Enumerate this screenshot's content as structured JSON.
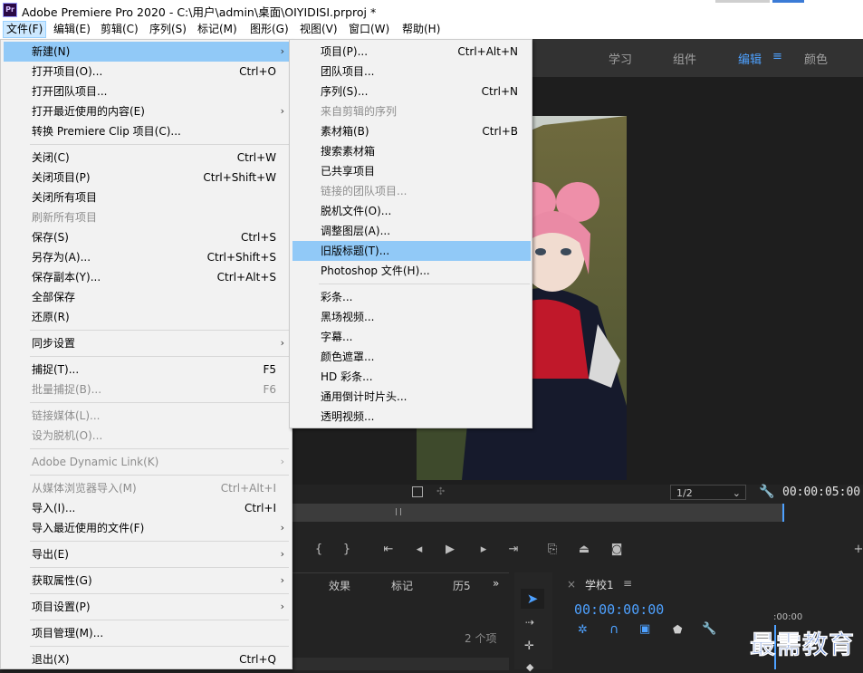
{
  "window": {
    "title": "Adobe Premiere Pro 2020 - C:\\用户\\admin\\桌面\\OIYIDISI.prproj *",
    "logo": "Pr"
  },
  "menubar": [
    "文件(F)",
    "编辑(E)",
    "剪辑(C)",
    "序列(S)",
    "标记(M)",
    "图形(G)",
    "视图(V)",
    "窗口(W)",
    "帮助(H)"
  ],
  "workspaces": {
    "learn": "学习",
    "assembly": "组件",
    "editing": "编辑",
    "menu_icon": "≡",
    "color": "颜色"
  },
  "monitor": {
    "zoom": "1/2",
    "timecode": "00:00:05:00"
  },
  "panels": {
    "tabs": [
      "效果",
      "标记",
      "历5"
    ],
    "more": "»",
    "items_count": "2 个项",
    "sequence_tab": "学校1",
    "seq_menu": "≡",
    "sequence_timecode": "00:00:00:00",
    "ruler_time": ":00:00",
    "close": "×"
  },
  "file_menu": [
    {
      "label": "新建(N)",
      "shortcut": "",
      "submenu": true,
      "highlight": true,
      "disabled": false
    },
    {
      "label": "打开项目(O)...",
      "shortcut": "Ctrl+O",
      "submenu": false,
      "disabled": false
    },
    {
      "label": "打开团队项目...",
      "shortcut": "",
      "submenu": false,
      "disabled": false
    },
    {
      "label": "打开最近使用的内容(E)",
      "shortcut": "",
      "submenu": true,
      "disabled": false
    },
    {
      "label": "转换 Premiere Clip 项目(C)...",
      "shortcut": "",
      "submenu": false,
      "disabled": false
    },
    {
      "sep": true
    },
    {
      "label": "关闭(C)",
      "shortcut": "Ctrl+W",
      "submenu": false,
      "disabled": false
    },
    {
      "label": "关闭项目(P)",
      "shortcut": "Ctrl+Shift+W",
      "submenu": false,
      "disabled": false
    },
    {
      "label": "关闭所有项目",
      "shortcut": "",
      "submenu": false,
      "disabled": false
    },
    {
      "label": "刷新所有项目",
      "shortcut": "",
      "submenu": false,
      "disabled": true
    },
    {
      "label": "保存(S)",
      "shortcut": "Ctrl+S",
      "submenu": false,
      "disabled": false
    },
    {
      "label": "另存为(A)...",
      "shortcut": "Ctrl+Shift+S",
      "submenu": false,
      "disabled": false
    },
    {
      "label": "保存副本(Y)...",
      "shortcut": "Ctrl+Alt+S",
      "submenu": false,
      "disabled": false
    },
    {
      "label": "全部保存",
      "shortcut": "",
      "submenu": false,
      "disabled": false
    },
    {
      "label": "还原(R)",
      "shortcut": "",
      "submenu": false,
      "disabled": false
    },
    {
      "sep": true
    },
    {
      "label": "同步设置",
      "shortcut": "",
      "submenu": true,
      "disabled": false
    },
    {
      "sep": true
    },
    {
      "label": "捕捉(T)...",
      "shortcut": "F5",
      "submenu": false,
      "disabled": false
    },
    {
      "label": "批量捕捉(B)...",
      "shortcut": "F6",
      "submenu": false,
      "disabled": true
    },
    {
      "sep": true
    },
    {
      "label": "链接媒体(L)...",
      "shortcut": "",
      "submenu": false,
      "disabled": true
    },
    {
      "label": "设为脱机(O)...",
      "shortcut": "",
      "submenu": false,
      "disabled": true
    },
    {
      "sep": true
    },
    {
      "label": "Adobe Dynamic Link(K)",
      "shortcut": "",
      "submenu": true,
      "disabled": true
    },
    {
      "sep": true
    },
    {
      "label": "从媒体浏览器导入(M)",
      "shortcut": "Ctrl+Alt+I",
      "submenu": false,
      "disabled": true
    },
    {
      "label": "导入(I)...",
      "shortcut": "Ctrl+I",
      "submenu": false,
      "disabled": false
    },
    {
      "label": "导入最近使用的文件(F)",
      "shortcut": "",
      "submenu": true,
      "disabled": false
    },
    {
      "sep": true
    },
    {
      "label": "导出(E)",
      "shortcut": "",
      "submenu": true,
      "disabled": false
    },
    {
      "sep": true
    },
    {
      "label": "获取属性(G)",
      "shortcut": "",
      "submenu": true,
      "disabled": false
    },
    {
      "sep": true
    },
    {
      "label": "项目设置(P)",
      "shortcut": "",
      "submenu": true,
      "disabled": false
    },
    {
      "sep": true
    },
    {
      "label": "项目管理(M)...",
      "shortcut": "",
      "submenu": false,
      "disabled": false
    },
    {
      "sep": true
    },
    {
      "label": "退出(X)",
      "shortcut": "Ctrl+Q",
      "submenu": false,
      "disabled": false
    }
  ],
  "new_submenu": [
    {
      "label": "项目(P)...",
      "shortcut": "Ctrl+Alt+N",
      "disabled": false
    },
    {
      "label": "团队项目...",
      "shortcut": "",
      "disabled": false
    },
    {
      "label": "序列(S)...",
      "shortcut": "Ctrl+N",
      "disabled": false
    },
    {
      "label": "来自剪辑的序列",
      "shortcut": "",
      "disabled": true
    },
    {
      "label": "素材箱(B)",
      "shortcut": "Ctrl+B",
      "disabled": false
    },
    {
      "label": "搜索素材箱",
      "shortcut": "",
      "disabled": false
    },
    {
      "label": "已共享项目",
      "shortcut": "",
      "disabled": false
    },
    {
      "label": "链接的团队项目...",
      "shortcut": "",
      "disabled": true
    },
    {
      "label": "脱机文件(O)...",
      "shortcut": "",
      "disabled": false
    },
    {
      "label": "调整图层(A)...",
      "shortcut": "",
      "disabled": false
    },
    {
      "label": "旧版标题(T)...",
      "shortcut": "",
      "disabled": false,
      "highlight": true
    },
    {
      "label": "Photoshop 文件(H)...",
      "shortcut": "",
      "disabled": false
    },
    {
      "sep": true
    },
    {
      "label": "彩条...",
      "shortcut": "",
      "disabled": false
    },
    {
      "label": "黑场视频...",
      "shortcut": "",
      "disabled": false
    },
    {
      "label": "字幕...",
      "shortcut": "",
      "disabled": false
    },
    {
      "label": "颜色遮罩...",
      "shortcut": "",
      "disabled": false
    },
    {
      "label": "HD 彩条...",
      "shortcut": "",
      "disabled": false
    },
    {
      "label": "通用倒计时片头...",
      "shortcut": "",
      "disabled": false
    },
    {
      "label": "透明视频...",
      "shortcut": "",
      "disabled": false
    }
  ],
  "watermark": "最需教育",
  "colors": {
    "highlight": "#91c9f7",
    "menu_bg": "#f2f2f2",
    "accent_blue": "#4ea1ff"
  }
}
